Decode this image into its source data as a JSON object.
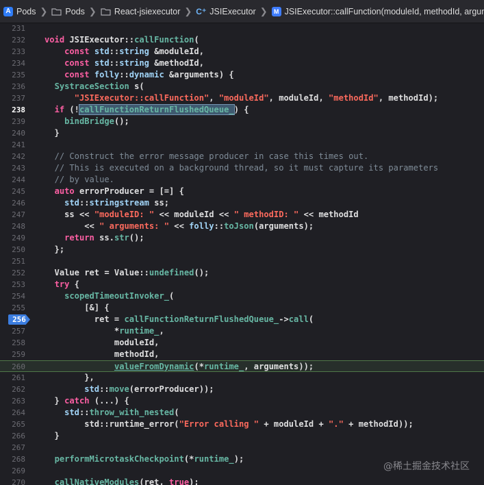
{
  "breadcrumb": {
    "items": [
      {
        "label": "Pods",
        "icon": "xcode-project-icon"
      },
      {
        "label": "Pods",
        "icon": "folder-icon"
      },
      {
        "label": "React-jsiexecutor",
        "icon": "folder-icon"
      },
      {
        "label": "JSIExecutor",
        "icon": "cpp-file-icon"
      },
      {
        "label": "JSIExecutor::callFunction(moduleId, methodId, arguments)",
        "icon": "method-icon"
      }
    ],
    "separator": "❯"
  },
  "editor": {
    "current_line": "238",
    "breakpoint_line": "256",
    "highlighted_line": "260",
    "lines": [
      {
        "n": "231",
        "t": []
      },
      {
        "n": "232",
        "t": [
          [
            "kw",
            "void "
          ],
          [
            "",
            "JSIExecutor::"
          ],
          [
            "fn",
            "callFunction"
          ],
          [
            "",
            "("
          ]
        ]
      },
      {
        "n": "233",
        "t": [
          [
            "",
            "    "
          ],
          [
            "kw",
            "const "
          ],
          [
            "ty",
            "std"
          ],
          [
            "",
            "::"
          ],
          [
            "ty",
            "string "
          ],
          [
            "",
            "&moduleId,"
          ]
        ]
      },
      {
        "n": "234",
        "t": [
          [
            "",
            "    "
          ],
          [
            "kw",
            "const "
          ],
          [
            "ty",
            "std"
          ],
          [
            "",
            "::"
          ],
          [
            "ty",
            "string "
          ],
          [
            "",
            "&methodId,"
          ]
        ]
      },
      {
        "n": "235",
        "t": [
          [
            "",
            "    "
          ],
          [
            "kw",
            "const "
          ],
          [
            "ty",
            "folly"
          ],
          [
            "",
            "::"
          ],
          [
            "ty",
            "dynamic "
          ],
          [
            "",
            "&arguments) {"
          ]
        ]
      },
      {
        "n": "236",
        "t": [
          [
            "",
            "  "
          ],
          [
            "fn",
            "SystraceSection "
          ],
          [
            "",
            "s("
          ]
        ]
      },
      {
        "n": "237",
        "t": [
          [
            "",
            "      "
          ],
          [
            "str",
            "\"JSIExecutor::callFunction\""
          ],
          [
            "",
            ", "
          ],
          [
            "str",
            "\"moduleId\""
          ],
          [
            "",
            ", moduleId, "
          ],
          [
            "str",
            "\"methodId\""
          ],
          [
            "",
            ", methodId);"
          ]
        ]
      },
      {
        "n": "238",
        "t": [
          [
            "",
            "  "
          ],
          [
            "kw",
            "if "
          ],
          [
            "",
            "(!"
          ],
          [
            "fn sel",
            "callFunctionReturnFlushedQueue_"
          ],
          [
            "",
            ") {"
          ]
        ]
      },
      {
        "n": "239",
        "t": [
          [
            "",
            "    "
          ],
          [
            "fn",
            "bindBridge"
          ],
          [
            "",
            "();"
          ]
        ]
      },
      {
        "n": "240",
        "t": [
          [
            "",
            "  }"
          ]
        ]
      },
      {
        "n": "241",
        "t": []
      },
      {
        "n": "242",
        "t": [
          [
            "",
            "  "
          ],
          [
            "cm",
            "// Construct the error message producer in case this times out."
          ]
        ]
      },
      {
        "n": "243",
        "t": [
          [
            "",
            "  "
          ],
          [
            "cm",
            "// This is executed on a background thread, so it must capture its parameters"
          ]
        ]
      },
      {
        "n": "244",
        "t": [
          [
            "",
            "  "
          ],
          [
            "cm",
            "// by value."
          ]
        ]
      },
      {
        "n": "245",
        "t": [
          [
            "",
            "  "
          ],
          [
            "kw",
            "auto "
          ],
          [
            "",
            "errorProducer = [=] {"
          ]
        ]
      },
      {
        "n": "246",
        "t": [
          [
            "",
            "    "
          ],
          [
            "ty",
            "std"
          ],
          [
            "",
            "::"
          ],
          [
            "ty",
            "stringstream "
          ],
          [
            "",
            "ss;"
          ]
        ]
      },
      {
        "n": "247",
        "t": [
          [
            "",
            "    ss << "
          ],
          [
            "str",
            "\"moduleID: \""
          ],
          [
            "",
            " << moduleId << "
          ],
          [
            "str",
            "\" methodID: \""
          ],
          [
            "",
            "",
            " << methodId"
          ]
        ]
      },
      {
        "n": "248",
        "t": [
          [
            "",
            "        << "
          ],
          [
            "str",
            "\" arguments: \""
          ],
          [
            "",
            "",
            " << "
          ],
          [
            "ty",
            "folly"
          ],
          [
            "",
            "::"
          ],
          [
            "fn",
            "toJson"
          ],
          [
            "",
            "(arguments);"
          ]
        ]
      },
      {
        "n": "249",
        "t": [
          [
            "",
            "    "
          ],
          [
            "kw",
            "return "
          ],
          [
            "",
            "ss."
          ],
          [
            "fn",
            "str"
          ],
          [
            "",
            "();"
          ]
        ]
      },
      {
        "n": "250",
        "t": [
          [
            "",
            "  };"
          ]
        ]
      },
      {
        "n": "251",
        "t": []
      },
      {
        "n": "252",
        "t": [
          [
            "",
            "  Value ret = Value::"
          ],
          [
            "fn",
            "undefined"
          ],
          [
            "",
            "();"
          ]
        ]
      },
      {
        "n": "253",
        "t": [
          [
            "",
            "  "
          ],
          [
            "kw",
            "try "
          ],
          [
            "",
            "{"
          ]
        ]
      },
      {
        "n": "254",
        "t": [
          [
            "",
            "    "
          ],
          [
            "fn",
            "scopedTimeoutInvoker_"
          ],
          [
            "",
            "("
          ]
        ]
      },
      {
        "n": "255",
        "t": [
          [
            "",
            "        [&] {"
          ]
        ]
      },
      {
        "n": "256",
        "t": [
          [
            "",
            "          ret = "
          ],
          [
            "fn",
            "callFunctionReturnFlushedQueue_"
          ],
          [
            "",
            "->"
          ],
          [
            "fn",
            "call"
          ],
          [
            "",
            "("
          ]
        ]
      },
      {
        "n": "257",
        "t": [
          [
            "",
            "              *"
          ],
          [
            "fn",
            "runtime_"
          ],
          [
            "",
            ","
          ]
        ]
      },
      {
        "n": "258",
        "t": [
          [
            "",
            "              moduleId,"
          ]
        ]
      },
      {
        "n": "259",
        "t": [
          [
            "",
            "              methodId,"
          ]
        ]
      },
      {
        "n": "260",
        "t": [
          [
            "",
            "              "
          ],
          [
            "fn under",
            "valueFromDynamic"
          ],
          [
            "",
            "(*"
          ],
          [
            "fn",
            "runtime_"
          ],
          [
            "",
            ", arguments));"
          ]
        ]
      },
      {
        "n": "261",
        "t": [
          [
            "",
            "        },"
          ]
        ]
      },
      {
        "n": "262",
        "t": [
          [
            "",
            "        "
          ],
          [
            "ty",
            "std"
          ],
          [
            "",
            "::"
          ],
          [
            "fn",
            "move"
          ],
          [
            "",
            "(errorProducer));"
          ]
        ]
      },
      {
        "n": "263",
        "t": [
          [
            "",
            "  } "
          ],
          [
            "kw",
            "catch "
          ],
          [
            "",
            "(...) {"
          ]
        ]
      },
      {
        "n": "264",
        "t": [
          [
            "",
            "    "
          ],
          [
            "ty",
            "std"
          ],
          [
            "",
            "::"
          ],
          [
            "fn",
            "throw_with_nested"
          ],
          [
            "",
            "("
          ]
        ]
      },
      {
        "n": "265",
        "t": [
          [
            "",
            "        std::runtime_error("
          ],
          [
            "str",
            "\"Error calling \""
          ],
          [
            "",
            "",
            " + moduleId + "
          ],
          [
            "str",
            "\".\""
          ],
          [
            "",
            "",
            " + methodId));"
          ]
        ]
      },
      {
        "n": "266",
        "t": [
          [
            "",
            "  }"
          ]
        ]
      },
      {
        "n": "267",
        "t": []
      },
      {
        "n": "268",
        "t": [
          [
            "",
            "  "
          ],
          [
            "fn",
            "performMicrotaskCheckpoint"
          ],
          [
            "",
            "(*"
          ],
          [
            "fn",
            "runtime_"
          ],
          [
            "",
            ");"
          ]
        ]
      },
      {
        "n": "269",
        "t": []
      },
      {
        "n": "270",
        "t": [
          [
            "",
            "  "
          ],
          [
            "fn",
            "callNativeModules"
          ],
          [
            "",
            "(ret, "
          ],
          [
            "kw",
            "true"
          ],
          [
            "",
            ");"
          ]
        ]
      }
    ]
  },
  "watermark": "@稀土掘金技术社区",
  "colors": {
    "background": "#1f1f24",
    "keyword": "#fc5fa3",
    "type": "#a1d4f7",
    "function": "#67b7a4",
    "string": "#fc6a5d",
    "comment": "#7f8c98",
    "breakpoint": "#3b7de0"
  }
}
